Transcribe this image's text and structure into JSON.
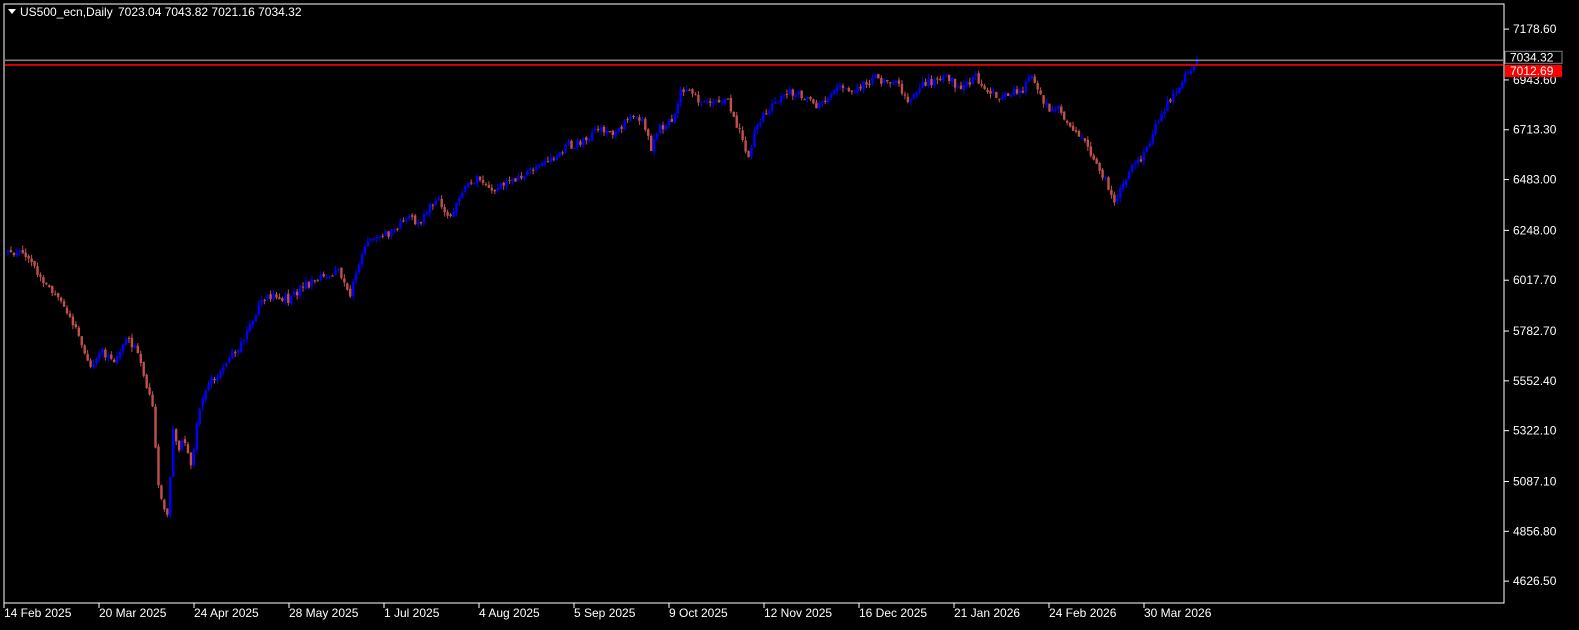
{
  "header": {
    "collapse_icon": "triangle-down-icon",
    "symbol_label": "US500_ecn,Daily",
    "ohlc_label": "7023.04 7043.82 7021.16 7034.32"
  },
  "chart_data": {
    "type": "candlestick",
    "title": "US500_ecn,Daily",
    "ohlc": {
      "open": 7023.04,
      "high": 7043.82,
      "low": 7021.16,
      "close": 7034.32
    },
    "ylim": [
      4530,
      7290
    ],
    "y_ticks": [
      "7178.60",
      "6943.60",
      "6713.30",
      "6483.00",
      "6248.00",
      "6017.70",
      "5782.70",
      "5552.40",
      "5322.10",
      "5087.10",
      "4856.80",
      "4626.50"
    ],
    "x_ticks": [
      "14 Feb 2025",
      "20 Mar 2025",
      "24 Apr 2025",
      "28 May 2025",
      "1 Jul 2025",
      "4 Aug 2025",
      "5 Sep 2025",
      "9 Oct 2025",
      "12 Nov 2025",
      "16 Dec 2025",
      "21 Jan 2026",
      "24 Feb 2026",
      "30 Mar 2026"
    ],
    "price_lines": [
      {
        "label": "7034.32",
        "value": 7034.32,
        "color": "#808080"
      },
      {
        "label": "7012.69",
        "value": 7012.69,
        "color": "#ff0000"
      }
    ],
    "colors": {
      "bull": "#0000ff",
      "bear": "#c0504d",
      "grid_text": "#ffffff",
      "background": "#000000"
    },
    "anchors": [
      [
        0,
        6150
      ],
      [
        6,
        6140
      ],
      [
        10,
        6040
      ],
      [
        15,
        5970
      ],
      [
        20,
        5860
      ],
      [
        25,
        5730
      ],
      [
        28,
        5600
      ],
      [
        32,
        5690
      ],
      [
        36,
        5640
      ],
      [
        40,
        5760
      ],
      [
        43,
        5700
      ],
      [
        46,
        5590
      ],
      [
        49,
        5420
      ],
      [
        51,
        5060
      ],
      [
        54,
        4920
      ],
      [
        56,
        5320
      ],
      [
        58,
        5240
      ],
      [
        60,
        5280
      ],
      [
        62,
        5160
      ],
      [
        65,
        5430
      ],
      [
        68,
        5530
      ],
      [
        72,
        5600
      ],
      [
        76,
        5680
      ],
      [
        80,
        5740
      ],
      [
        85,
        5900
      ],
      [
        90,
        5950
      ],
      [
        95,
        5930
      ],
      [
        100,
        5990
      ],
      [
        105,
        6010
      ],
      [
        108,
        6050
      ],
      [
        112,
        6050
      ],
      [
        116,
        5950
      ],
      [
        120,
        6150
      ],
      [
        125,
        6230
      ],
      [
        130,
        6240
      ],
      [
        135,
        6300
      ],
      [
        140,
        6290
      ],
      [
        145,
        6400
      ],
      [
        150,
        6320
      ],
      [
        155,
        6450
      ],
      [
        160,
        6500
      ],
      [
        165,
        6430
      ],
      [
        170,
        6480
      ],
      [
        175,
        6510
      ],
      [
        180,
        6560
      ],
      [
        185,
        6590
      ],
      [
        190,
        6640
      ],
      [
        195,
        6660
      ],
      [
        200,
        6720
      ],
      [
        205,
        6700
      ],
      [
        210,
        6760
      ],
      [
        215,
        6770
      ],
      [
        218,
        6630
      ],
      [
        221,
        6720
      ],
      [
        225,
        6760
      ],
      [
        228,
        6890
      ],
      [
        232,
        6880
      ],
      [
        236,
        6830
      ],
      [
        240,
        6830
      ],
      [
        244,
        6840
      ],
      [
        248,
        6700
      ],
      [
        251,
        6590
      ],
      [
        254,
        6740
      ],
      [
        258,
        6810
      ],
      [
        262,
        6860
      ],
      [
        266,
        6890
      ],
      [
        270,
        6860
      ],
      [
        274,
        6820
      ],
      [
        278,
        6870
      ],
      [
        282,
        6930
      ],
      [
        286,
        6900
      ],
      [
        290,
        6920
      ],
      [
        294,
        6950
      ],
      [
        298,
        6940
      ],
      [
        302,
        6920
      ],
      [
        306,
        6840
      ],
      [
        310,
        6930
      ],
      [
        314,
        6940
      ],
      [
        318,
        6970
      ],
      [
        322,
        6900
      ],
      [
        325,
        6930
      ],
      [
        328,
        6960
      ],
      [
        332,
        6880
      ],
      [
        336,
        6870
      ],
      [
        340,
        6890
      ],
      [
        344,
        6900
      ],
      [
        347,
        6950
      ],
      [
        350,
        6860
      ],
      [
        354,
        6800
      ],
      [
        357,
        6810
      ],
      [
        360,
        6710
      ],
      [
        363,
        6690
      ],
      [
        366,
        6640
      ],
      [
        369,
        6540
      ],
      [
        372,
        6480
      ],
      [
        375,
        6360
      ],
      [
        378,
        6470
      ],
      [
        382,
        6560
      ],
      [
        385,
        6600
      ],
      [
        388,
        6700
      ],
      [
        391,
        6780
      ],
      [
        394,
        6860
      ],
      [
        397,
        6920
      ],
      [
        400,
        6990
      ],
      [
        403,
        7034
      ]
    ]
  }
}
